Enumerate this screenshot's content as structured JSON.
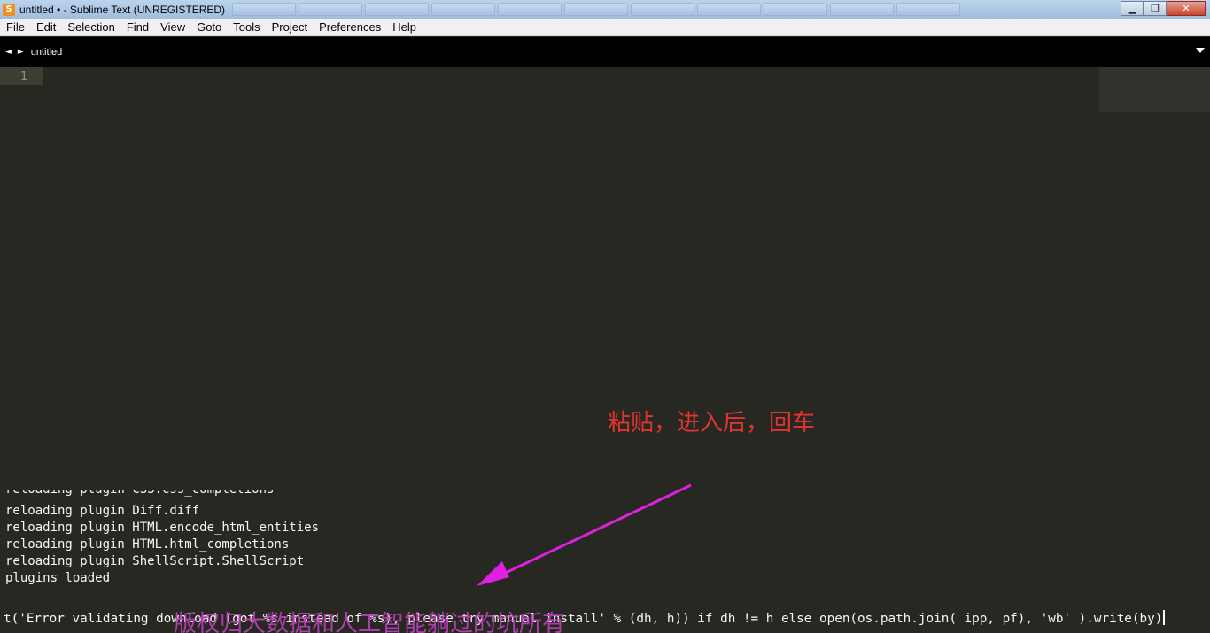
{
  "window": {
    "icon_letter": "S",
    "title": "untitled • - Sublime Text (UNREGISTERED)",
    "controls": {
      "minimize": "▁",
      "maximize": "❐",
      "close": "✕"
    }
  },
  "menu": {
    "items": [
      "File",
      "Edit",
      "Selection",
      "Find",
      "View",
      "Goto",
      "Tools",
      "Project",
      "Preferences",
      "Help"
    ]
  },
  "tabs": {
    "nav_arrows": "◄ ►",
    "active_tab": "untitled"
  },
  "editor": {
    "line_numbers": [
      "1"
    ],
    "colors": {
      "background": "#272822",
      "gutter_highlight": "#3e3d32",
      "text": "#f8f8f2"
    }
  },
  "console": {
    "lines": [
      "reloading plugin CSS.css_completions",
      "reloading plugin Diff.diff",
      "reloading plugin HTML.encode_html_entities",
      "reloading plugin HTML.html_completions",
      "reloading plugin ShellScript.ShellScript",
      "plugins loaded"
    ]
  },
  "input": {
    "value": "t('Error validating download (got %s instead of %s), please try manual install' % (dh, h)) if dh != h else open(os.path.join( ipp, pf), 'wb' ).write(by)"
  },
  "annotation": {
    "text": "粘贴，进入后，回车",
    "color": "#e3342f",
    "arrow_color": "#e020e0"
  },
  "watermark": {
    "text": "版权归大数据和人工智能躺过的坑所有"
  }
}
